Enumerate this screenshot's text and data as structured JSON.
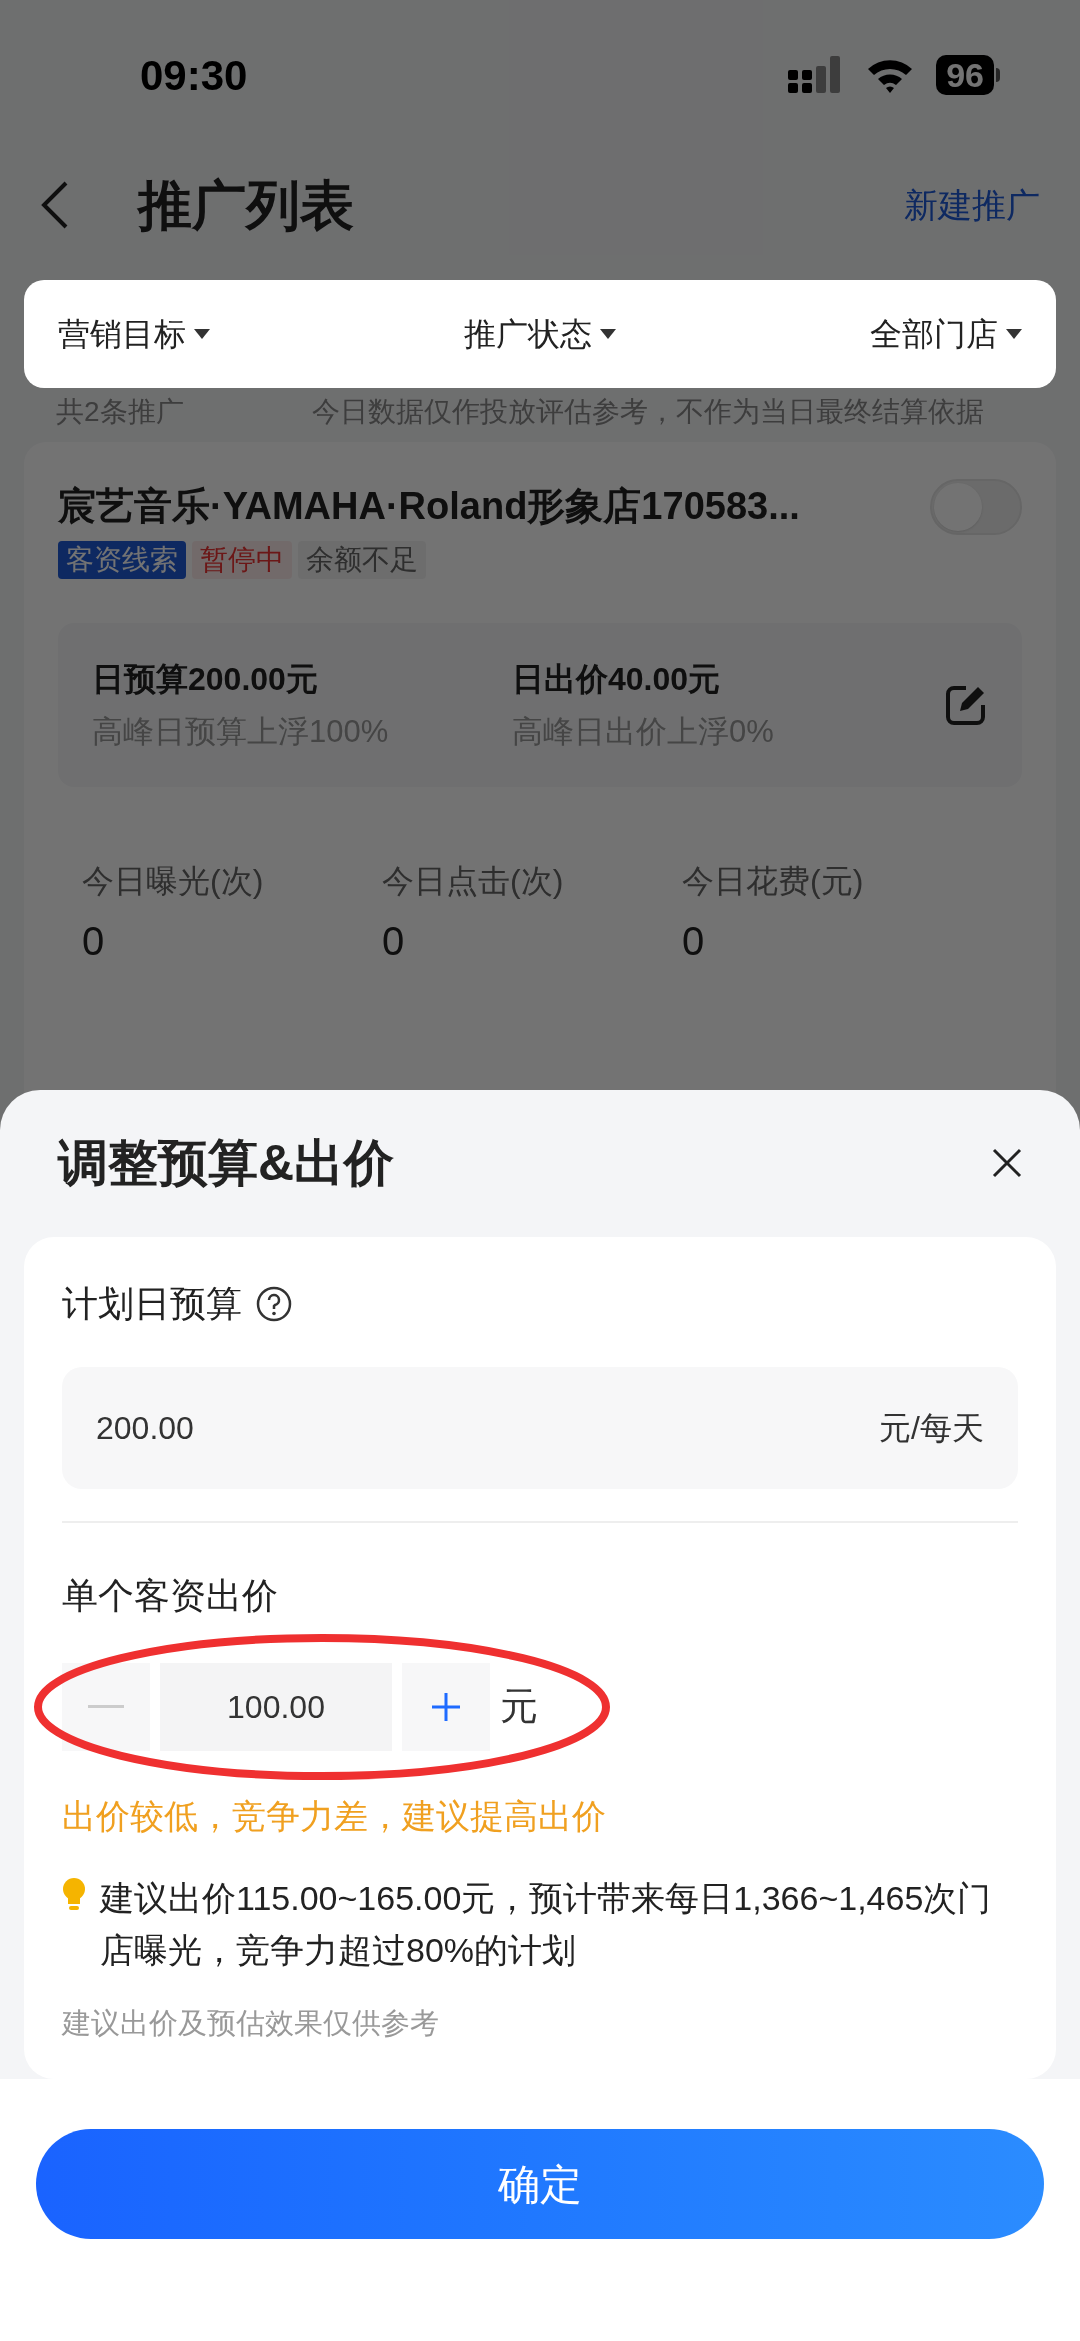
{
  "status_bar": {
    "time": "09:30",
    "battery": "96"
  },
  "nav": {
    "title": "推广列表",
    "action": "新建推广"
  },
  "filters": [
    {
      "label": "营销目标"
    },
    {
      "label": "推广状态"
    },
    {
      "label": "全部门店"
    }
  ],
  "info": {
    "count": "共2条推广",
    "notice": "今日数据仅作投放评估参考，不作为当日最终结算依据"
  },
  "campaign": {
    "name": "宸艺音乐·YAMAHA·Roland形象店170583...",
    "on": false,
    "tags": [
      {
        "label": "客资线索",
        "kind": "type"
      },
      {
        "label": "暂停中",
        "kind": "status"
      },
      {
        "label": "余额不足",
        "kind": "muted"
      }
    ],
    "budget": {
      "label": "日预算200.00元",
      "sub": "高峰日预算上浮100%"
    },
    "bid": {
      "label": "日出价40.00元",
      "sub": "高峰日出价上浮0%"
    },
    "stats": [
      {
        "label": "今日曝光(次)",
        "value": "0"
      },
      {
        "label": "今日点击(次)",
        "value": "0"
      },
      {
        "label": "今日花费(元)",
        "value": "0"
      }
    ]
  },
  "modal": {
    "title": "调整预算&出价",
    "budget_label": "计划日预算",
    "budget_value": "200.00",
    "budget_unit": "元/每天",
    "bid_label": "单个客资出价",
    "bid_value": "100.00",
    "bid_unit": "元",
    "minus_disabled": true,
    "warning": "出价较低，竞争力差，建议提高出价",
    "tip": "建议出价115.00~165.00元，预计带来每日1,366~1,465次门店曝光，竞争力超过80%的计划",
    "note": "建议出价及预估效果仅供参考",
    "confirm": "确定"
  }
}
